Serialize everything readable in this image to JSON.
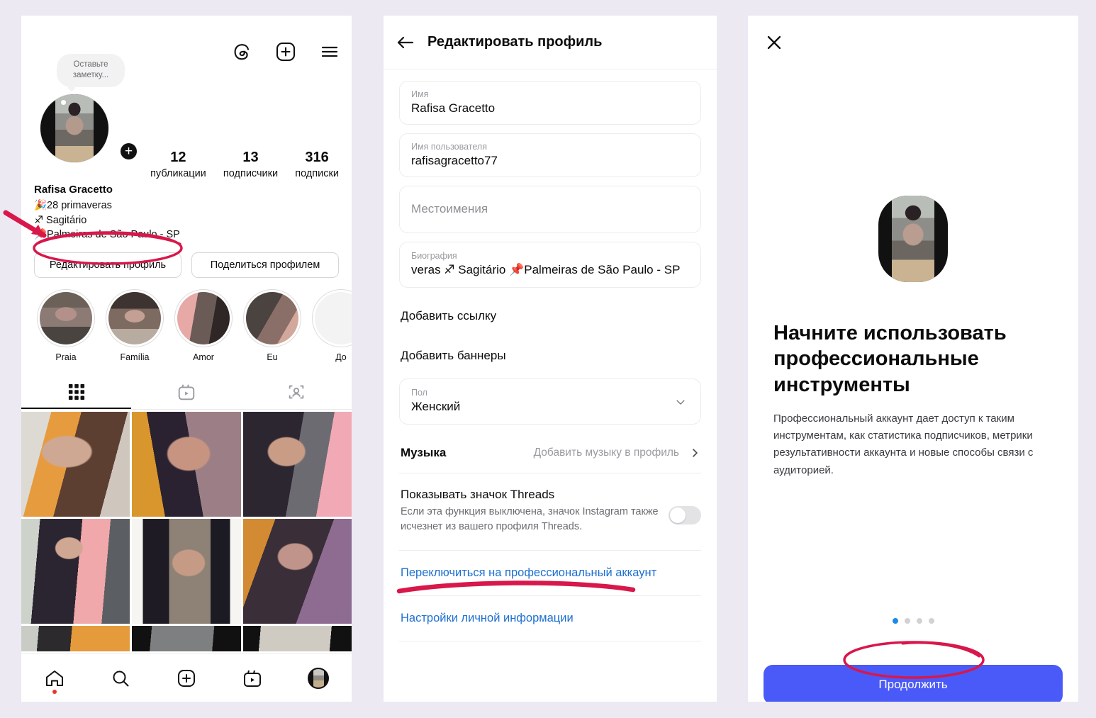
{
  "background_color": "#ECE9F3",
  "profile_panel": {
    "top_icons": [
      {
        "name": "threads-icon",
        "label": "Threads"
      },
      {
        "name": "new-post-icon",
        "label": "Создать"
      },
      {
        "name": "menu-icon",
        "label": "Меню"
      }
    ],
    "note_bubble": "Оставьте заметку...",
    "stats": [
      {
        "num": "12",
        "label": "публикации"
      },
      {
        "num": "13",
        "label": "подписчики"
      },
      {
        "num": "316",
        "label": "подписки"
      }
    ],
    "display_name": "Rafisa Gracetto",
    "bio_lines": [
      "🎉28 primaveras",
      "♐ Sagitário",
      "📌Palmeiras de São Paulo - SP"
    ],
    "buttons": {
      "edit_profile": "Редактировать профиль",
      "share_profile": "Поделиться профилем"
    },
    "highlights": [
      {
        "caption": "Praia"
      },
      {
        "caption": "Família"
      },
      {
        "caption": "Amor"
      },
      {
        "caption": "Eu"
      },
      {
        "caption": "Дo"
      }
    ],
    "tabs": [
      {
        "name": "grid-tab",
        "icon": "grid-icon",
        "active": true
      },
      {
        "name": "reels-tab",
        "icon": "reels-icon",
        "active": false
      },
      {
        "name": "tagged-tab",
        "icon": "tagged-person-icon",
        "active": false
      }
    ],
    "bottom_nav": [
      {
        "name": "home-icon",
        "badge": true
      },
      {
        "name": "search-icon",
        "badge": false
      },
      {
        "name": "create-icon",
        "badge": false
      },
      {
        "name": "reels-icon",
        "badge": false
      },
      {
        "name": "profile-avatar-icon",
        "badge": false
      }
    ]
  },
  "edit_panel": {
    "back_icon": "arrow-left-icon",
    "title": "Редактировать профиль",
    "fields": [
      {
        "label": "Имя",
        "value": "Rafisa Gracetto",
        "placeholder": ""
      },
      {
        "label": "Имя пользователя",
        "value": "rafisagracetto77",
        "placeholder": ""
      },
      {
        "label": "",
        "value": "",
        "placeholder": "Местоимения"
      },
      {
        "label": "Биография",
        "value": "veras ♐ Sagitário 📌Palmeiras de São Paulo - SP",
        "placeholder": ""
      }
    ],
    "add_link": "Добавить ссылку",
    "add_banners": "Добавить баннеры",
    "gender": {
      "label": "Пол",
      "value": "Женский",
      "chevron": "chevron-down-icon"
    },
    "music": {
      "label": "Музыка",
      "action": "Добавить музыку в профиль",
      "chevron": "chevron-right-icon"
    },
    "threads_badge": {
      "title": "Показывать значок Threads",
      "subtitle": "Если эта функция выключена, значок Instagram также исчезнет из вашего профиля Threads.",
      "toggle_on": false
    },
    "switch_pro": "Переключиться на профессиональный аккаунт",
    "personal_info": "Настройки личной информации"
  },
  "pro_panel": {
    "close_icon": "close-icon",
    "title": "Начните использовать профессиональные инструменты",
    "description": "Профессиональный аккаунт дает доступ к таким инструментам, как статистика подписчиков, метрики результативности аккаунта и новые способы связи с аудиторией.",
    "pagination": {
      "total": 4,
      "active_index": 0,
      "active_color": "#1B8AEA",
      "inactive_color": "#D2D2D6"
    },
    "cta_label": "Продолжить",
    "cta_color": "#4A5AF8"
  },
  "annotations": {
    "color": "#D8174A",
    "items": [
      {
        "name": "arrow-to-edit-profile",
        "type": "arrow"
      },
      {
        "name": "ellipse-edit-profile-button",
        "type": "ellipse"
      },
      {
        "name": "underline-switch-pro",
        "type": "underline"
      },
      {
        "name": "ellipse-continue-button",
        "type": "ellipse"
      }
    ]
  }
}
